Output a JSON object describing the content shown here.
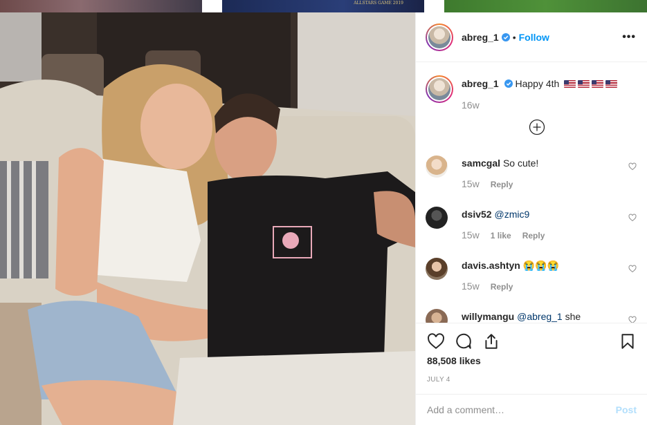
{
  "thumbnails": {
    "middle_text": "ALLSTARS GAME 2019"
  },
  "post": {
    "username": "abreg_1",
    "follow_label": "Follow",
    "more_label": "•••",
    "caption_text": "Happy 4th",
    "caption_flags": 4,
    "caption_time": "16w",
    "likes": "88,508 likes",
    "date": "JULY 4"
  },
  "comments": [
    {
      "username": "samcgal",
      "text": "So cute!",
      "time": "15w",
      "likes": "",
      "reply": "Reply"
    },
    {
      "username": "dsiv52",
      "mention": "@zmic9",
      "text": "",
      "time": "15w",
      "likes": "1 like",
      "reply": "Reply"
    },
    {
      "username": "davis.ashtyn",
      "text": "😭😭😭",
      "time": "15w",
      "likes": "",
      "reply": "Reply"
    },
    {
      "username": "willymangu",
      "mention": "@abreg_1",
      "text": "she",
      "time": "",
      "likes": "",
      "reply": ""
    }
  ],
  "add_comment": {
    "placeholder": "Add a comment…",
    "post_label": "Post"
  },
  "icons": {
    "verified": "verified-badge-icon",
    "more": "more-options-icon",
    "load_more": "load-more-comments-icon",
    "like": "heart-icon",
    "comment": "comment-icon",
    "share": "share-icon",
    "save": "bookmark-icon"
  },
  "colors": {
    "accent": "#0095f6",
    "text": "#262626",
    "muted": "#8e8e8e",
    "post_disabled": "#b2dffc"
  }
}
